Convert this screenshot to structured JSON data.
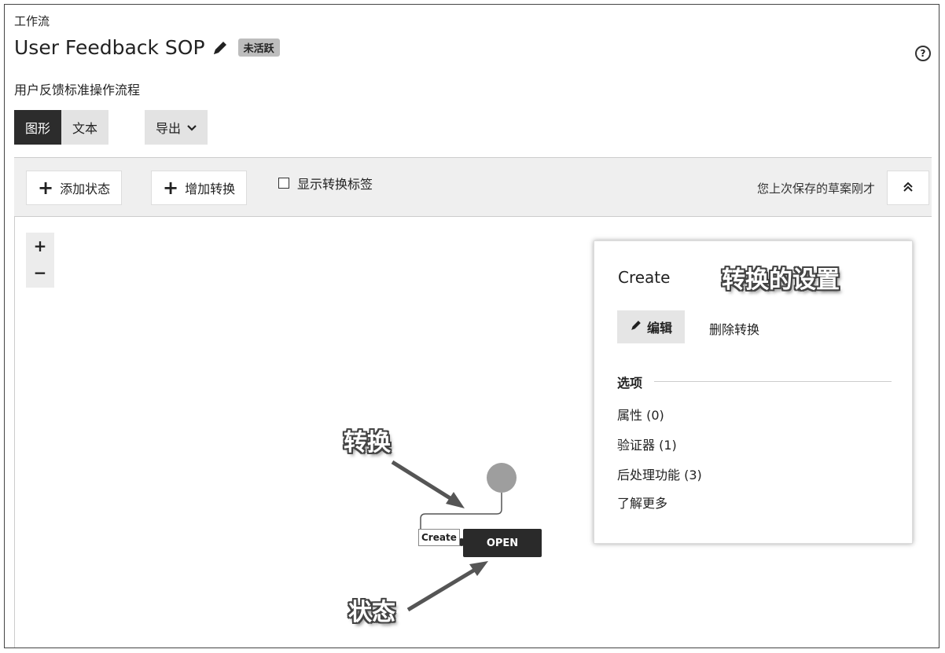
{
  "breadcrumb": "工作流",
  "title": "User Feedback SOP",
  "status_badge": "未活跃",
  "help_icon": "?",
  "description": "用户反馈标准操作流程",
  "view_tabs": [
    {
      "label": "图形",
      "active": true
    },
    {
      "label": "文本",
      "active": false
    }
  ],
  "export": {
    "label": "导出"
  },
  "toolbar": {
    "add_state": "添加状态",
    "add_transition": "增加转换",
    "show_transition_labels": "显示转换标签",
    "show_labels_checked": false,
    "saved_text": "您上次保存的草案刚才"
  },
  "zoom": {
    "in": "+",
    "out": "−"
  },
  "diagram": {
    "state_label": "OPEN",
    "transition_label": "Create"
  },
  "panel": {
    "title": "Create",
    "edit_label": "编辑",
    "delete_label": "删除转换",
    "options_heading": "选项",
    "options": [
      "属性 (0)",
      "验证器 (1)",
      "后处理功能 (3)",
      "了解更多"
    ]
  },
  "annotations": {
    "transition_settings": "转换的设置",
    "transition": "转换",
    "state": "状态"
  },
  "colors": {
    "active_tab": "#2c2c2c",
    "state_node": "#2a2a2a",
    "start_node": "#9e9e9e",
    "badge": "#bdbdbd"
  }
}
